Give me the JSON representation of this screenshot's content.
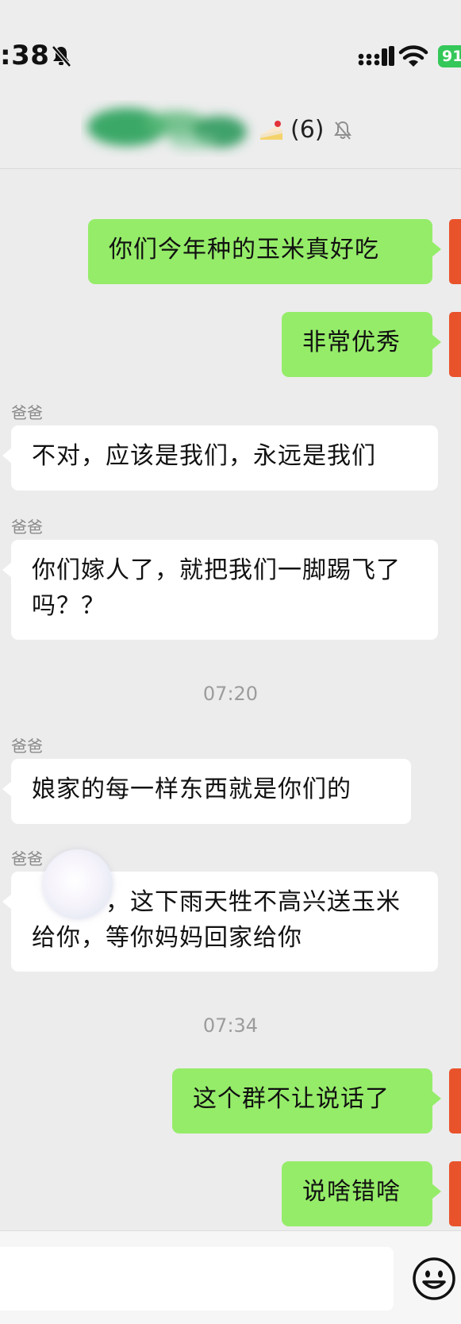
{
  "status_bar": {
    "time": ":38",
    "battery": "91"
  },
  "header": {
    "member_count": "(6)"
  },
  "messages": [
    {
      "text": "你们今年种的玉米真好吃"
    },
    {
      "text": "非常优秀"
    },
    {
      "sender": "爸爸",
      "text": "不对，应该是我们，永远是我们"
    },
    {
      "sender": "爸爸",
      "text": "你们嫁人了，就把我们一脚踢飞了吗？？"
    },
    {
      "time": "07:20"
    },
    {
      "sender": "爸爸",
      "text": "娘家的每一样东西就是你们的"
    },
    {
      "sender": "爸爸",
      "text": "　　　，这下雨天牲不高兴送玉米给你，等你妈妈回家给你"
    },
    {
      "time": "07:34"
    },
    {
      "text": "这个群不让说话了"
    },
    {
      "text": "说啥错啥"
    }
  ],
  "icons": {
    "bell_slash": "bell-slash-icon",
    "signal": "signal-icon",
    "wifi": "wifi-icon",
    "cake": "cake-icon",
    "emoji": "emoji-icon"
  },
  "colors": {
    "self_bubble": "#95ec69",
    "other_bubble": "#ffffff",
    "background": "#ededed"
  }
}
